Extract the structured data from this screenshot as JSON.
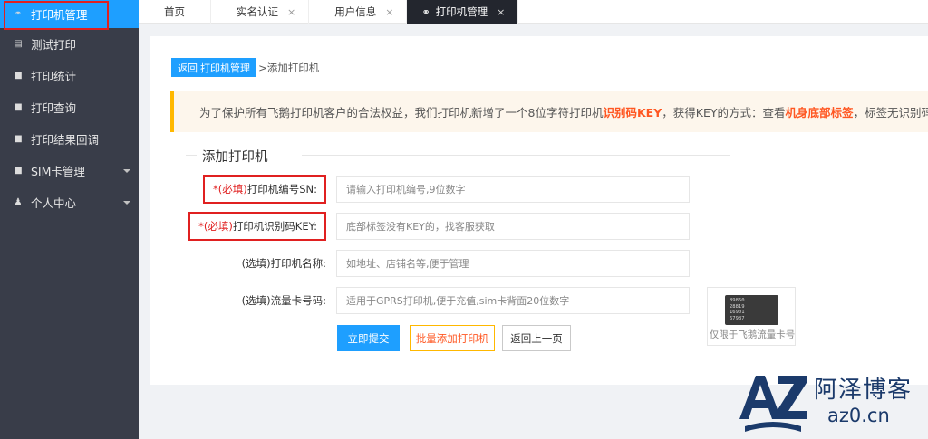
{
  "sidebar": {
    "items": [
      {
        "label": "打印机管理",
        "icon": "link-icon"
      },
      {
        "label": "测试打印",
        "icon": "document-icon"
      },
      {
        "label": "打印统计",
        "icon": "chat-icon"
      },
      {
        "label": "打印查询",
        "icon": "chat-icon"
      },
      {
        "label": "打印结果回调",
        "icon": "chat-icon"
      },
      {
        "label": "SIM卡管理",
        "icon": "chat-icon"
      },
      {
        "label": "个人中心",
        "icon": "user-icon"
      }
    ]
  },
  "tabs": {
    "home": "首页",
    "auth": "实名认证",
    "userinfo": "用户信息",
    "printer": "打印机管理",
    "close": "×"
  },
  "breadcrumb": {
    "back_label": "返回 打印机管理",
    "current": ">添加打印机"
  },
  "notice": {
    "part1": "为了保护所有飞鹅打印机客户的合法权益，我们打印机新增了一个8位字符打印机",
    "hl1": "识别码KEY",
    "part2": "，获得KEY的方式：查看",
    "hl2": "机身底部标签",
    "part3": "，标签无识别码的"
  },
  "form": {
    "legend": "添加打印机",
    "sn": {
      "req": "*(必填)",
      "label": "打印机编号SN:",
      "placeholder": "请输入打印机编号,9位数字"
    },
    "key": {
      "req": "*(必填)",
      "label": "打印机识别码KEY:",
      "placeholder": "底部标签没有KEY的，找客服获取"
    },
    "name": {
      "label": "(选填)打印机名称:",
      "placeholder": "如地址、店铺名等,便于管理"
    },
    "sim": {
      "label": "(选填)流量卡号码:",
      "placeholder": "适用于GPRS打印机,便于充值,sim卡背面20位数字"
    },
    "submit": "立即提交",
    "batch": "批量添加打印机",
    "back": "返回上一页"
  },
  "simcard": {
    "lines": [
      "89860",
      "28819",
      "16901",
      "67987"
    ],
    "caption": "仅限于飞鹅流量卡号"
  },
  "watermark": {
    "name": "阿泽博客",
    "url": "az0.cn",
    "logo_text": "AZ"
  },
  "colors": {
    "sidebar_bg": "#393d49",
    "accent": "#1e9fff",
    "highlight": "#ff5722",
    "warn_border": "#ffb800",
    "required": "#e02020"
  }
}
